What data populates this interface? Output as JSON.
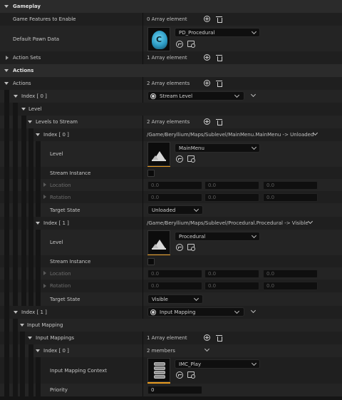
{
  "gameplay": {
    "header": "Gameplay",
    "game_features_label": "Game Features to Enable",
    "game_features_value": "0 Array element",
    "default_pawn_label": "Default Pawn Data",
    "default_pawn_value": "PD_Procedural",
    "action_sets_label": "Action Sets",
    "action_sets_value": "1 Array element"
  },
  "actions": {
    "header": "Actions",
    "actions_label": "Actions",
    "actions_value": "2 Array elements",
    "index0": {
      "label": "Index [ 0 ]",
      "type": "Stream Level",
      "level_header": "Level",
      "levels_to_stream_label": "Levels to Stream",
      "levels_to_stream_value": "2 Array elements",
      "entries": [
        {
          "label": "Index [ 0 ]",
          "summary": "/Game/Beryllium/Maps/Sublevel/MainMenu.MainMenu -> Unloaded",
          "level_label": "Level",
          "level_value": "MainMenu",
          "stream_instance_label": "Stream Instance",
          "location_label": "Location",
          "rotation_label": "Rotation",
          "location": [
            "0.0",
            "0.0",
            "0.0"
          ],
          "rotation": [
            "0.0",
            "0.0",
            "0.0"
          ],
          "target_state_label": "Target State",
          "target_state_value": "Unloaded"
        },
        {
          "label": "Index [ 1 ]",
          "summary": "/Game/Beryllium/Maps/Sublevel/Procedural.Procedural -> Visible",
          "level_label": "Level",
          "level_value": "Procedural",
          "stream_instance_label": "Stream Instance",
          "location_label": "Location",
          "rotation_label": "Rotation",
          "location": [
            "0.0",
            "0.0",
            "0.0"
          ],
          "rotation": [
            "0.0",
            "0.0",
            "0.0"
          ],
          "target_state_label": "Target State",
          "target_state_value": "Visible"
        }
      ]
    },
    "index1": {
      "label": "Index [ 1 ]",
      "type": "Input Mapping",
      "input_mapping_header": "Input Mapping",
      "input_mappings_label": "Input Mappings",
      "input_mappings_value": "1 Array element",
      "entry": {
        "label": "Index [ 0 ]",
        "value": "2 members",
        "context_label": "Input Mapping Context",
        "context_value": "IMC_Play",
        "priority_label": "Priority",
        "priority_value": "0"
      }
    }
  },
  "icons": {
    "add": "plus-circle-icon",
    "delete": "trash-icon",
    "browse": "browse-to-asset-icon",
    "use_selected": "use-selected-icon",
    "level_asset": "level-asset-icon"
  },
  "colors": {
    "accent": "#e79a1f",
    "background": "#151515"
  }
}
